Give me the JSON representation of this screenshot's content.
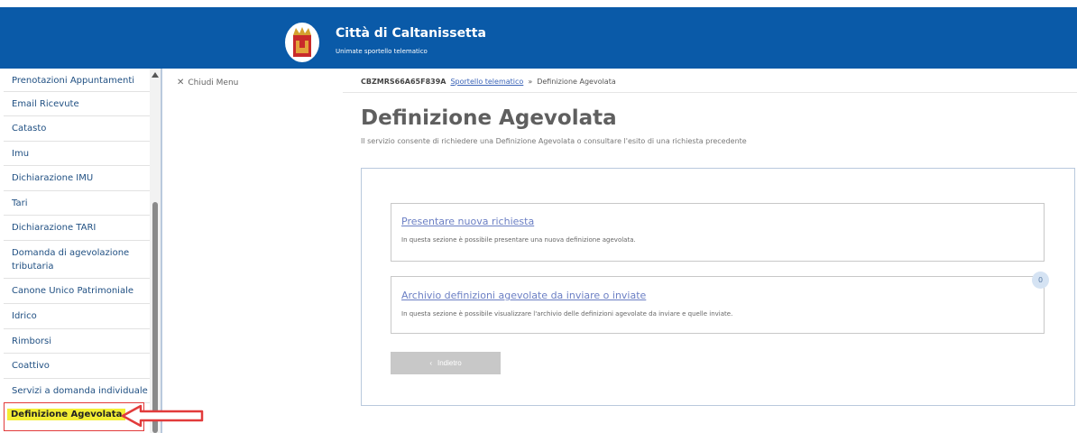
{
  "header": {
    "title": "Città di Caltanissetta",
    "subtitle": "Unimate sportello telematico",
    "background": "#0a5aa8"
  },
  "sidebar": {
    "items": [
      {
        "label": "Prenotazioni Appuntamenti"
      },
      {
        "label": "Email Ricevute"
      },
      {
        "label": "Catasto"
      },
      {
        "label": "Imu"
      },
      {
        "label": "Dichiarazione IMU"
      },
      {
        "label": "Tari"
      },
      {
        "label": "Dichiarazione TARI"
      },
      {
        "label": "Domanda di agevolazione tributaria"
      },
      {
        "label": "Canone Unico Patrimoniale"
      },
      {
        "label": "Idrico"
      },
      {
        "label": "Rimborsi"
      },
      {
        "label": "Coattivo"
      },
      {
        "label": "Servizi a domanda individuale"
      }
    ],
    "active_item": "Definizione Agevolata",
    "highlight_color": "#f3ee33",
    "annotation_color": "#e23b3b"
  },
  "toolbar": {
    "close_menu_label": "Chiudi Menu"
  },
  "breadcrumb": {
    "code": "CBZMRS66A65F839A",
    "link": "Sportello telematico",
    "separator": "»",
    "current": "Definizione Agevolata"
  },
  "main": {
    "title": "Definizione Agevolata",
    "description": "Il servizio consente di richiedere una Definizione Agevolata o consultare l'esito di una richiesta precedente",
    "cards": [
      {
        "link": "Presentare nuova richiesta",
        "text": "In questa sezione è possibile presentare una nuova definizione agevolata."
      },
      {
        "link": "Archivio definizioni agevolate da inviare o inviate",
        "text": "In questa sezione è possibile visualizzare l'archivio delle definizioni agevolate da inviare e quelle inviate.",
        "badge": "0"
      }
    ],
    "back_label": "Indietro"
  },
  "icons": {
    "logo": "city-coat-of-arms",
    "close": "close-icon",
    "scroll_up": "scroll-up-arrow-icon",
    "back": "chevron-left-icon",
    "annotation": "red-arrow-icon"
  }
}
